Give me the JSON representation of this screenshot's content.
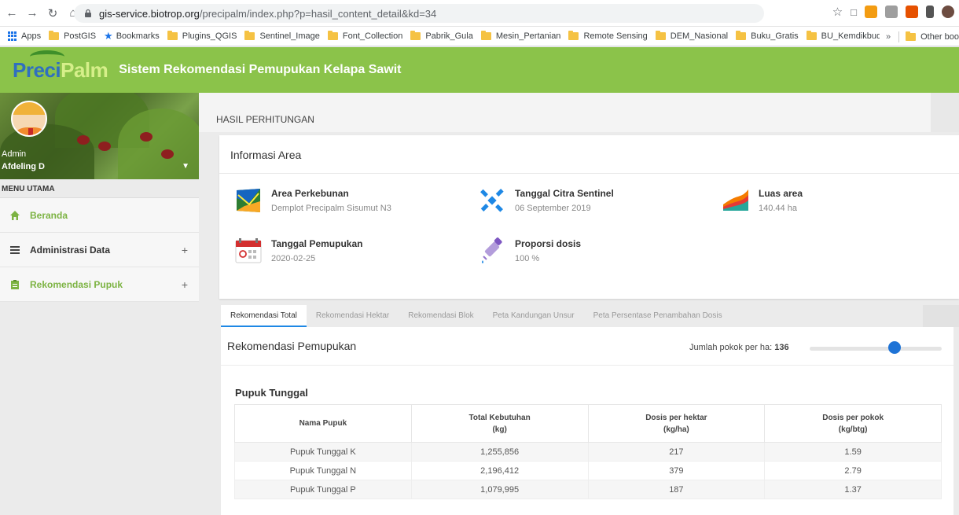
{
  "browser": {
    "url_host": "gis-service.biotrop.org",
    "url_path": "/precipalm/index.php?p=hasil_content_detail&kd=34",
    "bookmarks": [
      "Apps",
      "PostGIS",
      "Bookmarks",
      "Plugins_QGIS",
      "Sentinel_Image",
      "Font_Collection",
      "Pabrik_Gula",
      "Mesin_Pertanian",
      "Remote Sensing",
      "DEM_Nasional",
      "Buku_Gratis",
      "BU_Kemdikbud"
    ],
    "overflow": "»",
    "other_bookmarks": "Other boo"
  },
  "header": {
    "logo_part1": "Preci",
    "logo_part2": "Palm",
    "title": "Sistem Rekomendasi Pemupukan Kelapa Sawit"
  },
  "sidebar": {
    "role": "Admin",
    "username": "Afdeling D",
    "menu_heading": "MENU UTAMA",
    "items": [
      {
        "label": "Beranda"
      },
      {
        "label": "Administrasi Data",
        "expand": "+"
      },
      {
        "label": "Rekomendasi Pupuk",
        "expand": "+"
      }
    ]
  },
  "page": {
    "title": "HASIL PERHITUNGAN"
  },
  "info": {
    "title": "Informasi Area",
    "blocks": [
      {
        "label": "Area Perkebunan",
        "value": "Demplot Precipalm Sisumut N3"
      },
      {
        "label": "Tanggal Citra Sentinel",
        "value": "06 September 2019"
      },
      {
        "label": "Luas area",
        "value": "140.44 ha"
      },
      {
        "label": "Tanggal Pemupukan",
        "value": "2020-02-25"
      },
      {
        "label": "Proporsi dosis",
        "value": "100 %"
      }
    ]
  },
  "tabs": [
    "Rekomendasi Total",
    "Rekomendasi Hektar",
    "Rekomendasi Blok",
    "Peta Kandungan Unsur",
    "Peta Persentase Penambahan Dosis"
  ],
  "rekomendasi": {
    "title": "Rekomendasi Pemupukan",
    "slider_label": "Jumlah pokok per ha:",
    "slider_value": "136",
    "slider_fraction": 0.64,
    "section": "Pupuk Tunggal",
    "columns": [
      {
        "line1": "Nama Pupuk",
        "line2": ""
      },
      {
        "line1": "Total Kebutuhan",
        "line2": "(kg)"
      },
      {
        "line1": "Dosis per hektar",
        "line2": "(kg/ha)"
      },
      {
        "line1": "Dosis per pokok",
        "line2": "(kg/btg)"
      }
    ],
    "rows": [
      [
        "Pupuk Tunggal K",
        "1,255,856",
        "217",
        "1.59"
      ],
      [
        "Pupuk Tunggal N",
        "2,196,412",
        "379",
        "2.79"
      ],
      [
        "Pupuk Tunggal P",
        "1,079,995",
        "187",
        "1.37"
      ]
    ]
  },
  "colors": {
    "header_green": "#8bc34a",
    "menu_green": "#7cb342",
    "slider_blue": "#1e73d6",
    "tab_active_blue": "#1e88e5"
  }
}
